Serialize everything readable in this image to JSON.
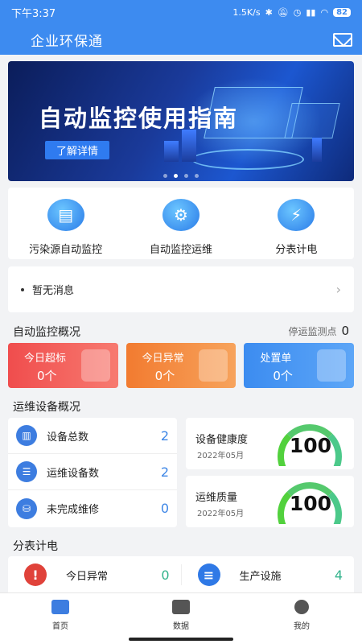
{
  "status_bar": {
    "time": "下午3:37",
    "speed": "1.5K/s",
    "battery": "82"
  },
  "app": {
    "title": "企业环保通"
  },
  "banner": {
    "title": "自动监控使用指南",
    "button": "了解详情",
    "dots": 4,
    "active_dot": 1
  },
  "quick_actions": [
    {
      "label": "污染源自动监控",
      "icon": "monitor-icon",
      "glyph": "▤"
    },
    {
      "label": "自动监控运维",
      "icon": "wrench-icon",
      "glyph": "⚙"
    },
    {
      "label": "分表计电",
      "icon": "lightning-icon",
      "glyph": "⚡"
    }
  ],
  "message": {
    "text": "暂无消息",
    "arrow": "›"
  },
  "monitoring": {
    "title": "自动监控概况",
    "stopped_label": "停运监测点",
    "stopped_value": "0",
    "cards": [
      {
        "label": "今日超标",
        "value": "0个",
        "color": "#f04d4d"
      },
      {
        "label": "今日异常",
        "value": "0个",
        "color": "#f27b30"
      },
      {
        "label": "处置单",
        "value": "0个",
        "color": "#3c8cf0"
      }
    ]
  },
  "devices": {
    "title": "运维设备概况",
    "rows": [
      {
        "label": "设备总数",
        "value": "2",
        "icon": "cabinet-icon"
      },
      {
        "label": "运维设备数",
        "value": "2",
        "icon": "server-icon"
      },
      {
        "label": "未完成维修",
        "value": "0",
        "icon": "database-icon"
      }
    ],
    "gauges": [
      {
        "label": "设备健康度",
        "date": "2022年05月",
        "value": "100"
      },
      {
        "label": "运维质量",
        "date": "2022年05月",
        "value": "100"
      }
    ]
  },
  "metering": {
    "title": "分表计电",
    "items": [
      {
        "label": "今日异常",
        "value": "0",
        "icon": "alert-icon",
        "glyph": "!",
        "color": "#e0423a"
      },
      {
        "label": "生产设施",
        "value": "4",
        "icon": "clipboard-icon",
        "glyph": "≡",
        "color": "#2f79e6"
      }
    ]
  },
  "tabs": [
    {
      "label": "首页",
      "icon": "home-icon",
      "active": true
    },
    {
      "label": "数据",
      "icon": "chart-icon",
      "active": false
    },
    {
      "label": "我的",
      "icon": "user-icon",
      "active": false
    }
  ]
}
